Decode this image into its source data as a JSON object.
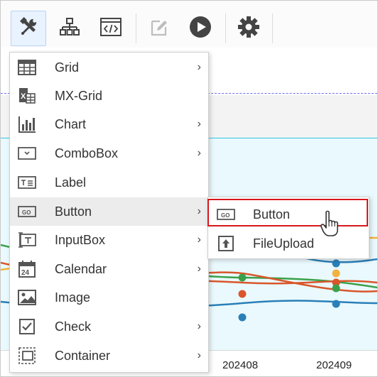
{
  "toolbar": {
    "buttons": [
      {
        "name": "tools-icon"
      },
      {
        "name": "hierarchy-icon"
      },
      {
        "name": "code-icon"
      },
      {
        "name": "edit-icon"
      },
      {
        "name": "play-icon"
      },
      {
        "name": "gear-icon"
      }
    ]
  },
  "menu": {
    "items": [
      {
        "label": "Grid",
        "icon": "grid-icon",
        "has_submenu": true
      },
      {
        "label": "MX-Grid",
        "icon": "mx-grid-icon",
        "has_submenu": false
      },
      {
        "label": "Chart",
        "icon": "chart-icon",
        "has_submenu": true
      },
      {
        "label": "ComboBox",
        "icon": "combobox-icon",
        "has_submenu": true
      },
      {
        "label": "Label",
        "icon": "label-icon",
        "has_submenu": false
      },
      {
        "label": "Button",
        "icon": "button-icon",
        "has_submenu": true
      },
      {
        "label": "InputBox",
        "icon": "inputbox-icon",
        "has_submenu": true
      },
      {
        "label": "Calendar",
        "icon": "calendar-icon",
        "has_submenu": true
      },
      {
        "label": "Image",
        "icon": "image-icon",
        "has_submenu": false
      },
      {
        "label": "Check",
        "icon": "check-icon",
        "has_submenu": true
      },
      {
        "label": "Container",
        "icon": "container-icon",
        "has_submenu": true
      }
    ],
    "arrow": "›"
  },
  "submenu": {
    "items": [
      {
        "label": "Button",
        "icon": "button-icon"
      },
      {
        "label": "FileUpload",
        "icon": "upload-icon"
      }
    ]
  },
  "background_chart": {
    "x_labels": [
      "202408",
      "202409"
    ]
  },
  "colors": {
    "selection_border": "#d7191c",
    "chart_bg": "#eaf9fd",
    "accent_blue": "#2a7fb8"
  }
}
